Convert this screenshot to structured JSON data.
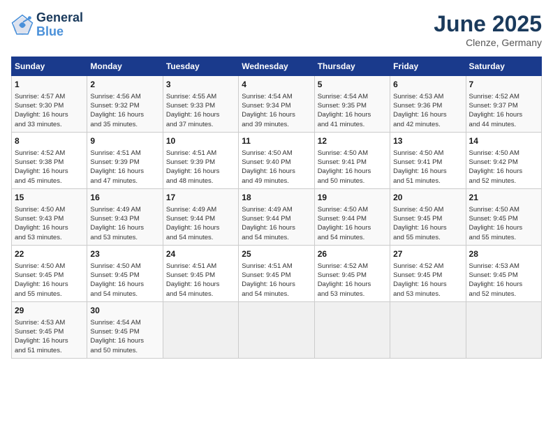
{
  "logo": {
    "line1": "General",
    "line2": "Blue"
  },
  "title": "June 2025",
  "subtitle": "Clenze, Germany",
  "headers": [
    "Sunday",
    "Monday",
    "Tuesday",
    "Wednesday",
    "Thursday",
    "Friday",
    "Saturday"
  ],
  "weeks": [
    [
      {
        "day": "1",
        "info": "Sunrise: 4:57 AM\nSunset: 9:30 PM\nDaylight: 16 hours\nand 33 minutes."
      },
      {
        "day": "2",
        "info": "Sunrise: 4:56 AM\nSunset: 9:32 PM\nDaylight: 16 hours\nand 35 minutes."
      },
      {
        "day": "3",
        "info": "Sunrise: 4:55 AM\nSunset: 9:33 PM\nDaylight: 16 hours\nand 37 minutes."
      },
      {
        "day": "4",
        "info": "Sunrise: 4:54 AM\nSunset: 9:34 PM\nDaylight: 16 hours\nand 39 minutes."
      },
      {
        "day": "5",
        "info": "Sunrise: 4:54 AM\nSunset: 9:35 PM\nDaylight: 16 hours\nand 41 minutes."
      },
      {
        "day": "6",
        "info": "Sunrise: 4:53 AM\nSunset: 9:36 PM\nDaylight: 16 hours\nand 42 minutes."
      },
      {
        "day": "7",
        "info": "Sunrise: 4:52 AM\nSunset: 9:37 PM\nDaylight: 16 hours\nand 44 minutes."
      }
    ],
    [
      {
        "day": "8",
        "info": "Sunrise: 4:52 AM\nSunset: 9:38 PM\nDaylight: 16 hours\nand 45 minutes."
      },
      {
        "day": "9",
        "info": "Sunrise: 4:51 AM\nSunset: 9:39 PM\nDaylight: 16 hours\nand 47 minutes."
      },
      {
        "day": "10",
        "info": "Sunrise: 4:51 AM\nSunset: 9:39 PM\nDaylight: 16 hours\nand 48 minutes."
      },
      {
        "day": "11",
        "info": "Sunrise: 4:50 AM\nSunset: 9:40 PM\nDaylight: 16 hours\nand 49 minutes."
      },
      {
        "day": "12",
        "info": "Sunrise: 4:50 AM\nSunset: 9:41 PM\nDaylight: 16 hours\nand 50 minutes."
      },
      {
        "day": "13",
        "info": "Sunrise: 4:50 AM\nSunset: 9:41 PM\nDaylight: 16 hours\nand 51 minutes."
      },
      {
        "day": "14",
        "info": "Sunrise: 4:50 AM\nSunset: 9:42 PM\nDaylight: 16 hours\nand 52 minutes."
      }
    ],
    [
      {
        "day": "15",
        "info": "Sunrise: 4:50 AM\nSunset: 9:43 PM\nDaylight: 16 hours\nand 53 minutes."
      },
      {
        "day": "16",
        "info": "Sunrise: 4:49 AM\nSunset: 9:43 PM\nDaylight: 16 hours\nand 53 minutes."
      },
      {
        "day": "17",
        "info": "Sunrise: 4:49 AM\nSunset: 9:44 PM\nDaylight: 16 hours\nand 54 minutes."
      },
      {
        "day": "18",
        "info": "Sunrise: 4:49 AM\nSunset: 9:44 PM\nDaylight: 16 hours\nand 54 minutes."
      },
      {
        "day": "19",
        "info": "Sunrise: 4:50 AM\nSunset: 9:44 PM\nDaylight: 16 hours\nand 54 minutes."
      },
      {
        "day": "20",
        "info": "Sunrise: 4:50 AM\nSunset: 9:45 PM\nDaylight: 16 hours\nand 55 minutes."
      },
      {
        "day": "21",
        "info": "Sunrise: 4:50 AM\nSunset: 9:45 PM\nDaylight: 16 hours\nand 55 minutes."
      }
    ],
    [
      {
        "day": "22",
        "info": "Sunrise: 4:50 AM\nSunset: 9:45 PM\nDaylight: 16 hours\nand 55 minutes."
      },
      {
        "day": "23",
        "info": "Sunrise: 4:50 AM\nSunset: 9:45 PM\nDaylight: 16 hours\nand 54 minutes."
      },
      {
        "day": "24",
        "info": "Sunrise: 4:51 AM\nSunset: 9:45 PM\nDaylight: 16 hours\nand 54 minutes."
      },
      {
        "day": "25",
        "info": "Sunrise: 4:51 AM\nSunset: 9:45 PM\nDaylight: 16 hours\nand 54 minutes."
      },
      {
        "day": "26",
        "info": "Sunrise: 4:52 AM\nSunset: 9:45 PM\nDaylight: 16 hours\nand 53 minutes."
      },
      {
        "day": "27",
        "info": "Sunrise: 4:52 AM\nSunset: 9:45 PM\nDaylight: 16 hours\nand 53 minutes."
      },
      {
        "day": "28",
        "info": "Sunrise: 4:53 AM\nSunset: 9:45 PM\nDaylight: 16 hours\nand 52 minutes."
      }
    ],
    [
      {
        "day": "29",
        "info": "Sunrise: 4:53 AM\nSunset: 9:45 PM\nDaylight: 16 hours\nand 51 minutes."
      },
      {
        "day": "30",
        "info": "Sunrise: 4:54 AM\nSunset: 9:45 PM\nDaylight: 16 hours\nand 50 minutes."
      },
      {
        "day": "",
        "info": ""
      },
      {
        "day": "",
        "info": ""
      },
      {
        "day": "",
        "info": ""
      },
      {
        "day": "",
        "info": ""
      },
      {
        "day": "",
        "info": ""
      }
    ]
  ]
}
